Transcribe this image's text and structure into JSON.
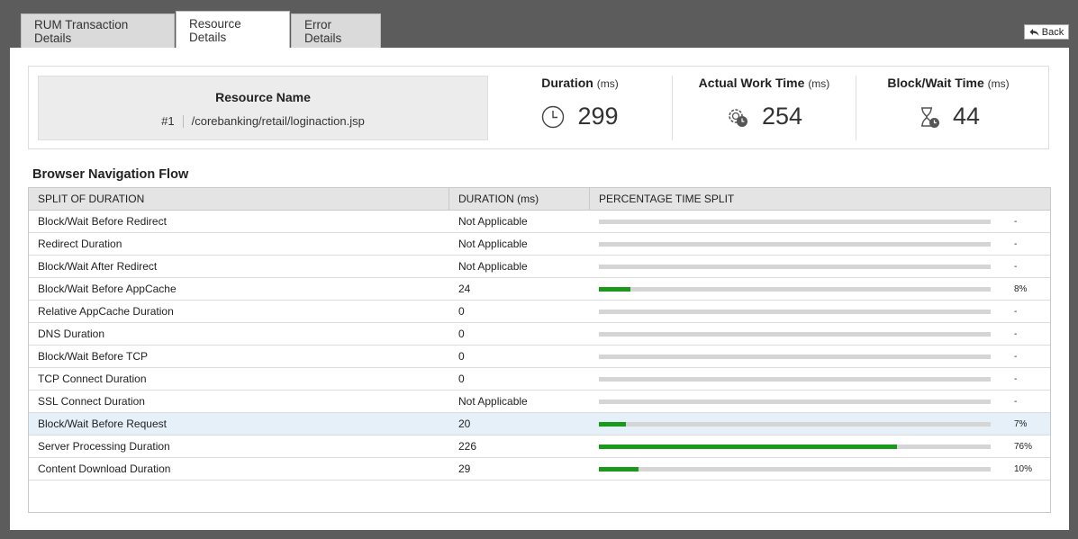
{
  "tabs": [
    {
      "label": "RUM Transaction Details",
      "active": false
    },
    {
      "label": "Resource Details",
      "active": true
    },
    {
      "label": "Error Details",
      "active": false
    }
  ],
  "back_label": "Back",
  "resource": {
    "title": "Resource Name",
    "number": "#1",
    "path": "/corebanking/retail/loginaction.jsp"
  },
  "metrics": [
    {
      "label": "Duration",
      "unit": "(ms)",
      "value": "299",
      "icon": "clock-icon"
    },
    {
      "label": "Actual Work Time",
      "unit": "(ms)",
      "value": "254",
      "icon": "gear-clock-icon"
    },
    {
      "label": "Block/Wait Time",
      "unit": "(ms)",
      "value": "44",
      "icon": "hourglass-clock-icon"
    }
  ],
  "section_title": "Browser Navigation Flow",
  "table": {
    "headers": [
      "SPLIT OF DURATION",
      "DURATION (ms)",
      "PERCENTAGE TIME SPLIT"
    ],
    "rows": [
      {
        "name": "Block/Wait Before Redirect",
        "duration": "Not Applicable",
        "pct": "-",
        "fraction": 0
      },
      {
        "name": "Redirect Duration",
        "duration": "Not Applicable",
        "pct": "-",
        "fraction": 0
      },
      {
        "name": "Block/Wait After Redirect",
        "duration": "Not Applicable",
        "pct": "-",
        "fraction": 0
      },
      {
        "name": "Block/Wait Before AppCache",
        "duration": "24",
        "pct": "8%",
        "fraction": 0.08
      },
      {
        "name": "Relative AppCache Duration",
        "duration": "0",
        "pct": "-",
        "fraction": 0
      },
      {
        "name": "DNS Duration",
        "duration": "0",
        "pct": "-",
        "fraction": 0
      },
      {
        "name": "Block/Wait Before TCP",
        "duration": "0",
        "pct": "-",
        "fraction": 0
      },
      {
        "name": "TCP Connect Duration",
        "duration": "0",
        "pct": "-",
        "fraction": 0
      },
      {
        "name": "SSL Connect Duration",
        "duration": "Not Applicable",
        "pct": "-",
        "fraction": 0
      },
      {
        "name": "Block/Wait Before Request",
        "duration": "20",
        "pct": "7%",
        "fraction": 0.07,
        "highlight": true
      },
      {
        "name": "Server Processing Duration",
        "duration": "226",
        "pct": "76%",
        "fraction": 0.76
      },
      {
        "name": "Content Download Duration",
        "duration": "29",
        "pct": "10%",
        "fraction": 0.1
      }
    ]
  },
  "colors": {
    "bar_fill": "#1a9a1a",
    "bar_track": "#d5d5d5",
    "highlight_row": "#e6f0f8"
  }
}
